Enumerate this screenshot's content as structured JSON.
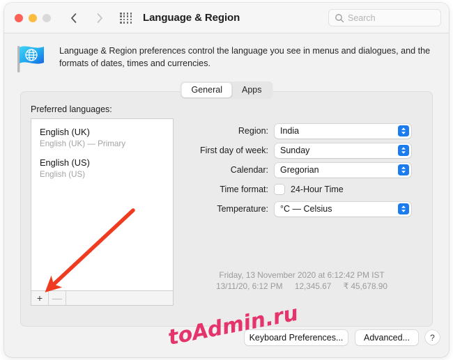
{
  "window": {
    "title": "Language & Region",
    "traffic_lights": [
      "close",
      "minimize",
      "maximize"
    ],
    "nav_back": "back-chevron",
    "nav_forward": "forward-chevron",
    "grid_button": "all-preferences-grid"
  },
  "search": {
    "placeholder": "Search",
    "value": "",
    "icon": "search-icon"
  },
  "description": {
    "icon": "flag-globe-icon",
    "text": "Language & Region preferences control the language you see in menus and dialogues, and the formats of dates, times and currencies."
  },
  "tabs": [
    {
      "label": "General",
      "active": true
    },
    {
      "label": "Apps",
      "active": false
    }
  ],
  "panel": {
    "preferred_languages_label": "Preferred languages:",
    "languages": [
      {
        "name": "English (UK)",
        "detail": "English (UK) — Primary"
      },
      {
        "name": "English (US)",
        "detail": "English (US)"
      }
    ],
    "list_toolbar": {
      "add_label": "+",
      "remove_label": "—"
    }
  },
  "form": {
    "rows": [
      {
        "label": "Region:",
        "value": "India",
        "control": "popup"
      },
      {
        "label": "First day of week:",
        "value": "Sunday",
        "control": "popup"
      },
      {
        "label": "Calendar:",
        "value": "Gregorian",
        "control": "popup"
      },
      {
        "label": "Time format:",
        "value": "24-Hour Time",
        "control": "checkbox",
        "checked": false
      },
      {
        "label": "Temperature:",
        "value": "°C — Celsius",
        "control": "popup"
      }
    ]
  },
  "preview": {
    "line1": "Friday, 13 November 2020 at 6:12:42 PM IST",
    "date_short": "13/11/20, 6:12 PM",
    "number": "12,345.67",
    "currency": "₹ 45,678.90"
  },
  "buttons": {
    "keyboard": "Keyboard Preferences...",
    "advanced": "Advanced...",
    "help": "?"
  },
  "annotations": {
    "watermark": "toAdmin.ru",
    "watermark_color": "#e5346b",
    "arrow_color": "#ef3b20",
    "arrow_target": "add-language-button"
  },
  "colors": {
    "accent": "#1a7ced",
    "window_bg": "#f2f2f2",
    "panel_bg": "#ebebeb"
  }
}
